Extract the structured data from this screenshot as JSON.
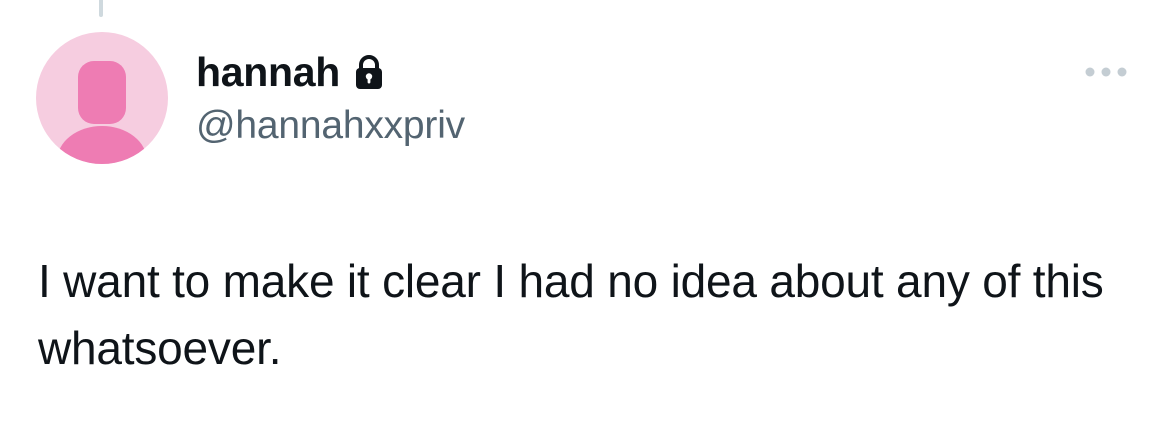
{
  "tweet": {
    "author": {
      "display_name": "hannah",
      "handle": "@hannahxxpriv",
      "protected_icon": "lock-icon",
      "avatar": "default-profile-silhouette"
    },
    "text": "I want to make it clear I had no idea about any of this whatsoever.",
    "more_icon": "more-options-icon"
  },
  "colors": {
    "text_primary": "#0f1419",
    "text_secondary": "#536471",
    "avatar_bg": "#f6cde0",
    "avatar_figure": "#ee7cb3",
    "more_dots": "#c4cdd3",
    "thread_line": "#cfd9de"
  }
}
